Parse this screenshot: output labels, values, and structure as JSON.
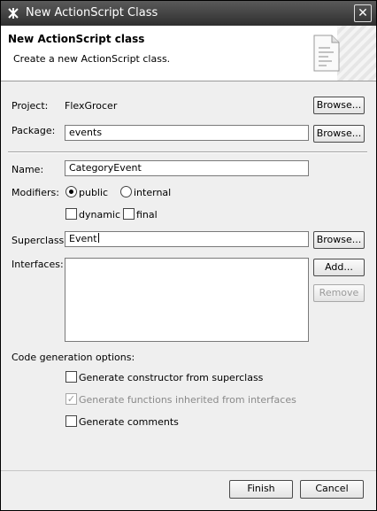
{
  "window": {
    "title": "New ActionScript Class",
    "close_glyph": "✕"
  },
  "banner": {
    "heading": "New ActionScript class",
    "description": "Create a new ActionScript class.",
    "icon": "new-class-wizard-icon"
  },
  "project": {
    "label": "Project:",
    "value": "FlexGrocer",
    "browse_label": "Browse..."
  },
  "package": {
    "label": "Package:",
    "value": "events",
    "browse_label": "Browse..."
  },
  "name": {
    "label": "Name:",
    "value": "CategoryEvent"
  },
  "modifiers": {
    "label": "Modifiers:",
    "public_label": "public",
    "public_selected": true,
    "internal_label": "internal",
    "internal_selected": false,
    "dynamic_label": "dynamic",
    "dynamic_checked": false,
    "final_label": "final",
    "final_checked": false
  },
  "superclass": {
    "label": "Superclass:",
    "value": "Event",
    "browse_label": "Browse..."
  },
  "interfaces": {
    "label": "Interfaces:",
    "items": [],
    "add_label": "Add...",
    "remove_label": "Remove"
  },
  "codegen": {
    "label": "Code generation options:",
    "options": [
      {
        "label": "Generate constructor from superclass",
        "checked": false,
        "enabled": true
      },
      {
        "label": "Generate functions inherited from interfaces",
        "checked": true,
        "enabled": false
      },
      {
        "label": "Generate comments",
        "checked": false,
        "enabled": true
      }
    ]
  },
  "footer": {
    "finish_label": "Finish",
    "cancel_label": "Cancel"
  },
  "colors": {
    "titlebar": "#3c3c3c",
    "dialog_bg": "#efefef",
    "banner_bg": "#ffffff"
  },
  "check_glyph": "✓"
}
